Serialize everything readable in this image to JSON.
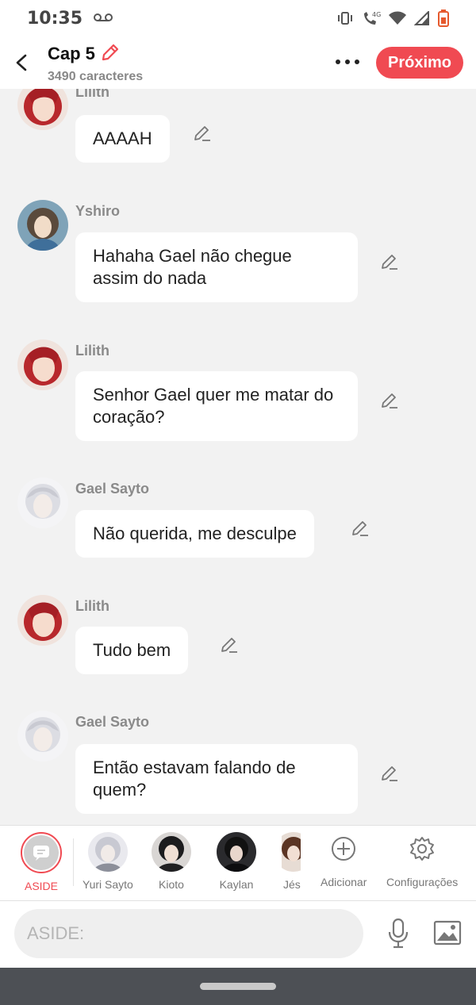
{
  "status_bar": {
    "time": "10:35",
    "network": "4G"
  },
  "header": {
    "title": "Cap 5",
    "char_count": "3490 caracteres",
    "next_label": "Próximo"
  },
  "messages": [
    {
      "speaker": "Lilith",
      "text": "AAAAH"
    },
    {
      "speaker": "Yshiro",
      "text": "Hahaha Gael não chegue assim do nada"
    },
    {
      "speaker": "Lilith",
      "text": "Senhor Gael quer me matar do coração?"
    },
    {
      "speaker": "Gael Sayto",
      "text": "Não querida, me desculpe"
    },
    {
      "speaker": "Lilith",
      "text": "Tudo bem"
    },
    {
      "speaker": "Gael Sayto",
      "text": "Então estavam falando de quem?"
    }
  ],
  "character_bar": {
    "aside_label": "ASIDE",
    "characters": [
      {
        "label": "Yuri Sayto"
      },
      {
        "label": "Kioto"
      },
      {
        "label": "Kaylan"
      },
      {
        "label": "Jés"
      }
    ],
    "add_label": "Adicionar",
    "settings_label": "Configurações"
  },
  "input": {
    "placeholder": "ASIDE:"
  },
  "colors": {
    "accent": "#f04a52",
    "background": "#f2f2f2",
    "bubble": "#ffffff"
  },
  "icons": [
    "voicemail-icon",
    "vibrate-icon",
    "call-4g-icon",
    "wifi-icon",
    "signal-icon",
    "battery-icon",
    "back-arrow-icon",
    "pencil-icon",
    "more-dots-icon",
    "edit-icon",
    "chat-bubble-icon",
    "add-circle-icon",
    "gear-icon",
    "microphone-icon",
    "image-icon"
  ]
}
